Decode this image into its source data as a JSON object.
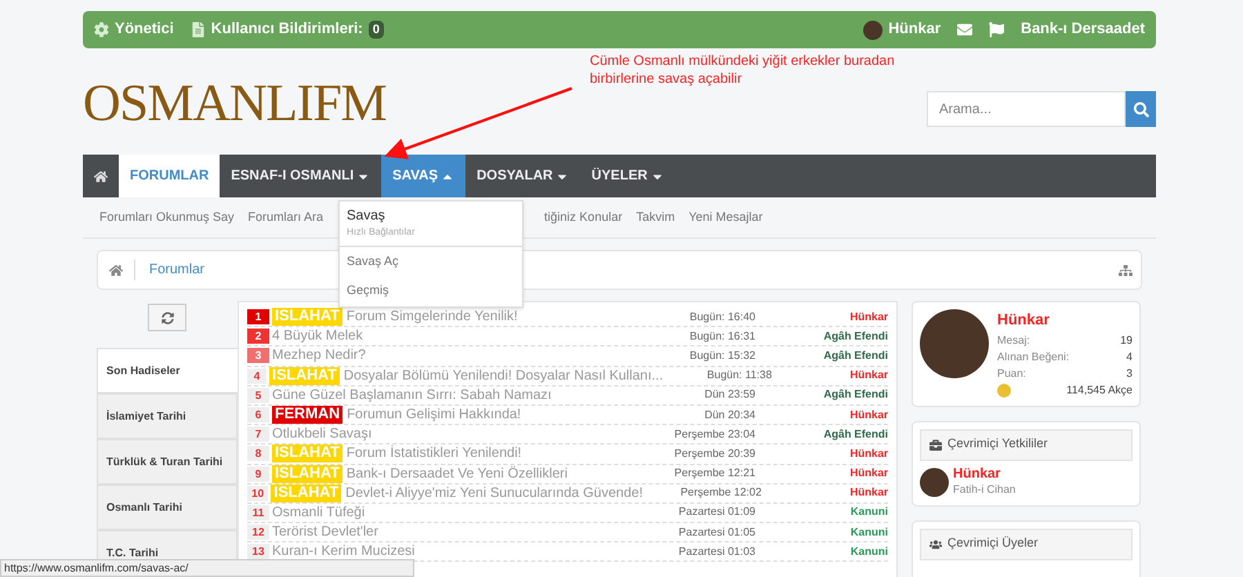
{
  "topbar": {
    "left": [
      {
        "label": "Yönetici",
        "kind": "gear"
      },
      {
        "label": "Kullanıcı Bildirimleri:",
        "kind": "doc",
        "count": "0"
      }
    ],
    "user": "Hünkar",
    "right_label": "Bank-ı Dersaadet"
  },
  "annotation": "Cümle Osmanlı mülkündeki yiğit erkekler buradan birbirlerine savaş açabilir",
  "logo": "OSMANLIFM",
  "search": {
    "placeholder": "Arama..."
  },
  "nav": [
    {
      "label": "FORUMLAR",
      "selected": true,
      "dropdown": false,
      "open": false
    },
    {
      "label": "ESNAF-I OSMANLI",
      "selected": false,
      "dropdown": true,
      "open": false
    },
    {
      "label": "SAVAŞ",
      "selected": false,
      "dropdown": true,
      "open": true
    },
    {
      "label": "DOSYALAR",
      "selected": false,
      "dropdown": true,
      "open": false
    },
    {
      "label": "ÜYELER",
      "selected": false,
      "dropdown": true,
      "open": false
    }
  ],
  "subnav": [
    "Forumları Okunmuş Say",
    "Forumları Ara",
    "tiğiniz Konular",
    "Takvim",
    "Yeni Mesajlar"
  ],
  "dropdown": {
    "title": "Savaş",
    "subtitle": "Hızlı Bağlantılar",
    "items": [
      "Savaş Aç",
      "Geçmiş"
    ]
  },
  "breadcrumb": [
    "Forumlar"
  ],
  "side_tabs": [
    {
      "label": "Son Hadiseler",
      "selected": true
    },
    {
      "label": "İslamiyet Tarihi",
      "selected": false
    },
    {
      "label": "Türklük & Turan Tarihi",
      "selected": false
    },
    {
      "label": "Osmanlı Tarihi",
      "selected": false
    },
    {
      "label": "T.C. Tarihi",
      "selected": false
    }
  ],
  "threads": [
    {
      "n": "1",
      "color": "#e00000",
      "tag": {
        "kind": "islahat",
        "text": "ISLAHAT"
      },
      "title": "Forum Simgelerinde Yenilik!",
      "time": "Bugün: 16:40",
      "author": {
        "name": "Hünkar",
        "color": "#ff2020"
      }
    },
    {
      "n": "2",
      "color": "#ee3333",
      "title": "4 Büyük Melek",
      "time": "Bugün: 16:31",
      "author": {
        "name": "Agâh Efendi",
        "color": "#2f6a4a"
      }
    },
    {
      "n": "3",
      "color": "#f07070",
      "title": "Mezhep Nedir?",
      "time": "Bugün: 15:32",
      "author": {
        "name": "Agâh Efendi",
        "color": "#2f6a4a"
      }
    },
    {
      "n": "4",
      "color": "#eeeeee",
      "tag": {
        "kind": "islahat",
        "text": "ISLAHAT"
      },
      "title": "Dosyalar Bölümü Yenilendi! Dosyalar Nasıl Kullanı...",
      "time": "Bugün: 11:38",
      "author": {
        "name": "Hünkar",
        "color": "#ff2020"
      }
    },
    {
      "n": "5",
      "color": "#eeeeee",
      "title": "Güne Güzel Başlamanın Sırrı: Sabah Namazı",
      "time": "Dün 23:59",
      "author": {
        "name": "Agâh Efendi",
        "color": "#2f6a4a"
      }
    },
    {
      "n": "6",
      "color": "#eeeeee",
      "tag": {
        "kind": "ferman",
        "text": "FERMAN"
      },
      "title": "Forumun Gelişimi Hakkında!",
      "time": "Dün 20:34",
      "author": {
        "name": "Hünkar",
        "color": "#ff2020"
      }
    },
    {
      "n": "7",
      "color": "#eeeeee",
      "title": "Otlukbeli Savaşı",
      "time": "Perşembe 23:04",
      "author": {
        "name": "Agâh Efendi",
        "color": "#2f6a4a"
      }
    },
    {
      "n": "8",
      "color": "#eeeeee",
      "tag": {
        "kind": "islahat",
        "text": "ISLAHAT"
      },
      "title": "Forum İstatistikleri Yenilendi!",
      "time": "Perşembe 20:39",
      "author": {
        "name": "Hünkar",
        "color": "#ff2020"
      }
    },
    {
      "n": "9",
      "color": "#eeeeee",
      "tag": {
        "kind": "islahat",
        "text": "ISLAHAT"
      },
      "title": "Bank-ı Dersaadet Ve Yeni Özellikleri",
      "time": "Perşembe 12:21",
      "author": {
        "name": "Hünkar",
        "color": "#ff2020"
      }
    },
    {
      "n": "10",
      "color": "#eeeeee",
      "tag": {
        "kind": "islahat",
        "text": "ISLAHAT"
      },
      "title": "Devlet-i Aliyye'miz Yeni Sunucularında Güvende!",
      "time": "Perşembe 12:02",
      "author": {
        "name": "Hünkar",
        "color": "#ff2020"
      }
    },
    {
      "n": "11",
      "color": "#eeeeee",
      "title": "Osmanli Tüfeği",
      "time": "Pazartesi 01:09",
      "author": {
        "name": "Kanuni",
        "color": "#2a9a5a"
      }
    },
    {
      "n": "12",
      "color": "#eeeeee",
      "title": "Terörist Devlet'ler",
      "time": "Pazartesi 01:05",
      "author": {
        "name": "Kanuni",
        "color": "#2a9a5a"
      }
    },
    {
      "n": "13",
      "color": "#eeeeee",
      "title": "Kuran-ı Kerim Mucizesi",
      "time": "Pazartesi 01:03",
      "author": {
        "name": "Kanuni",
        "color": "#2a9a5a"
      }
    }
  ],
  "profile": {
    "name": "Hünkar",
    "stats": [
      {
        "label": "Mesaj:",
        "value": "19"
      },
      {
        "label": "Alınan Beğeni:",
        "value": "4"
      },
      {
        "label": "Puan:",
        "value": "3"
      }
    ],
    "money": "114,545 Akçe"
  },
  "staff": {
    "title": "Çevrimiçi Yetkililer",
    "members": [
      {
        "name": "Hünkar",
        "title": "Fatih-i Cihan"
      }
    ]
  },
  "online": {
    "title": "Çevrimiçi Üyeler"
  },
  "status_url": "https://www.osmanlifm.com/savas-ac/"
}
